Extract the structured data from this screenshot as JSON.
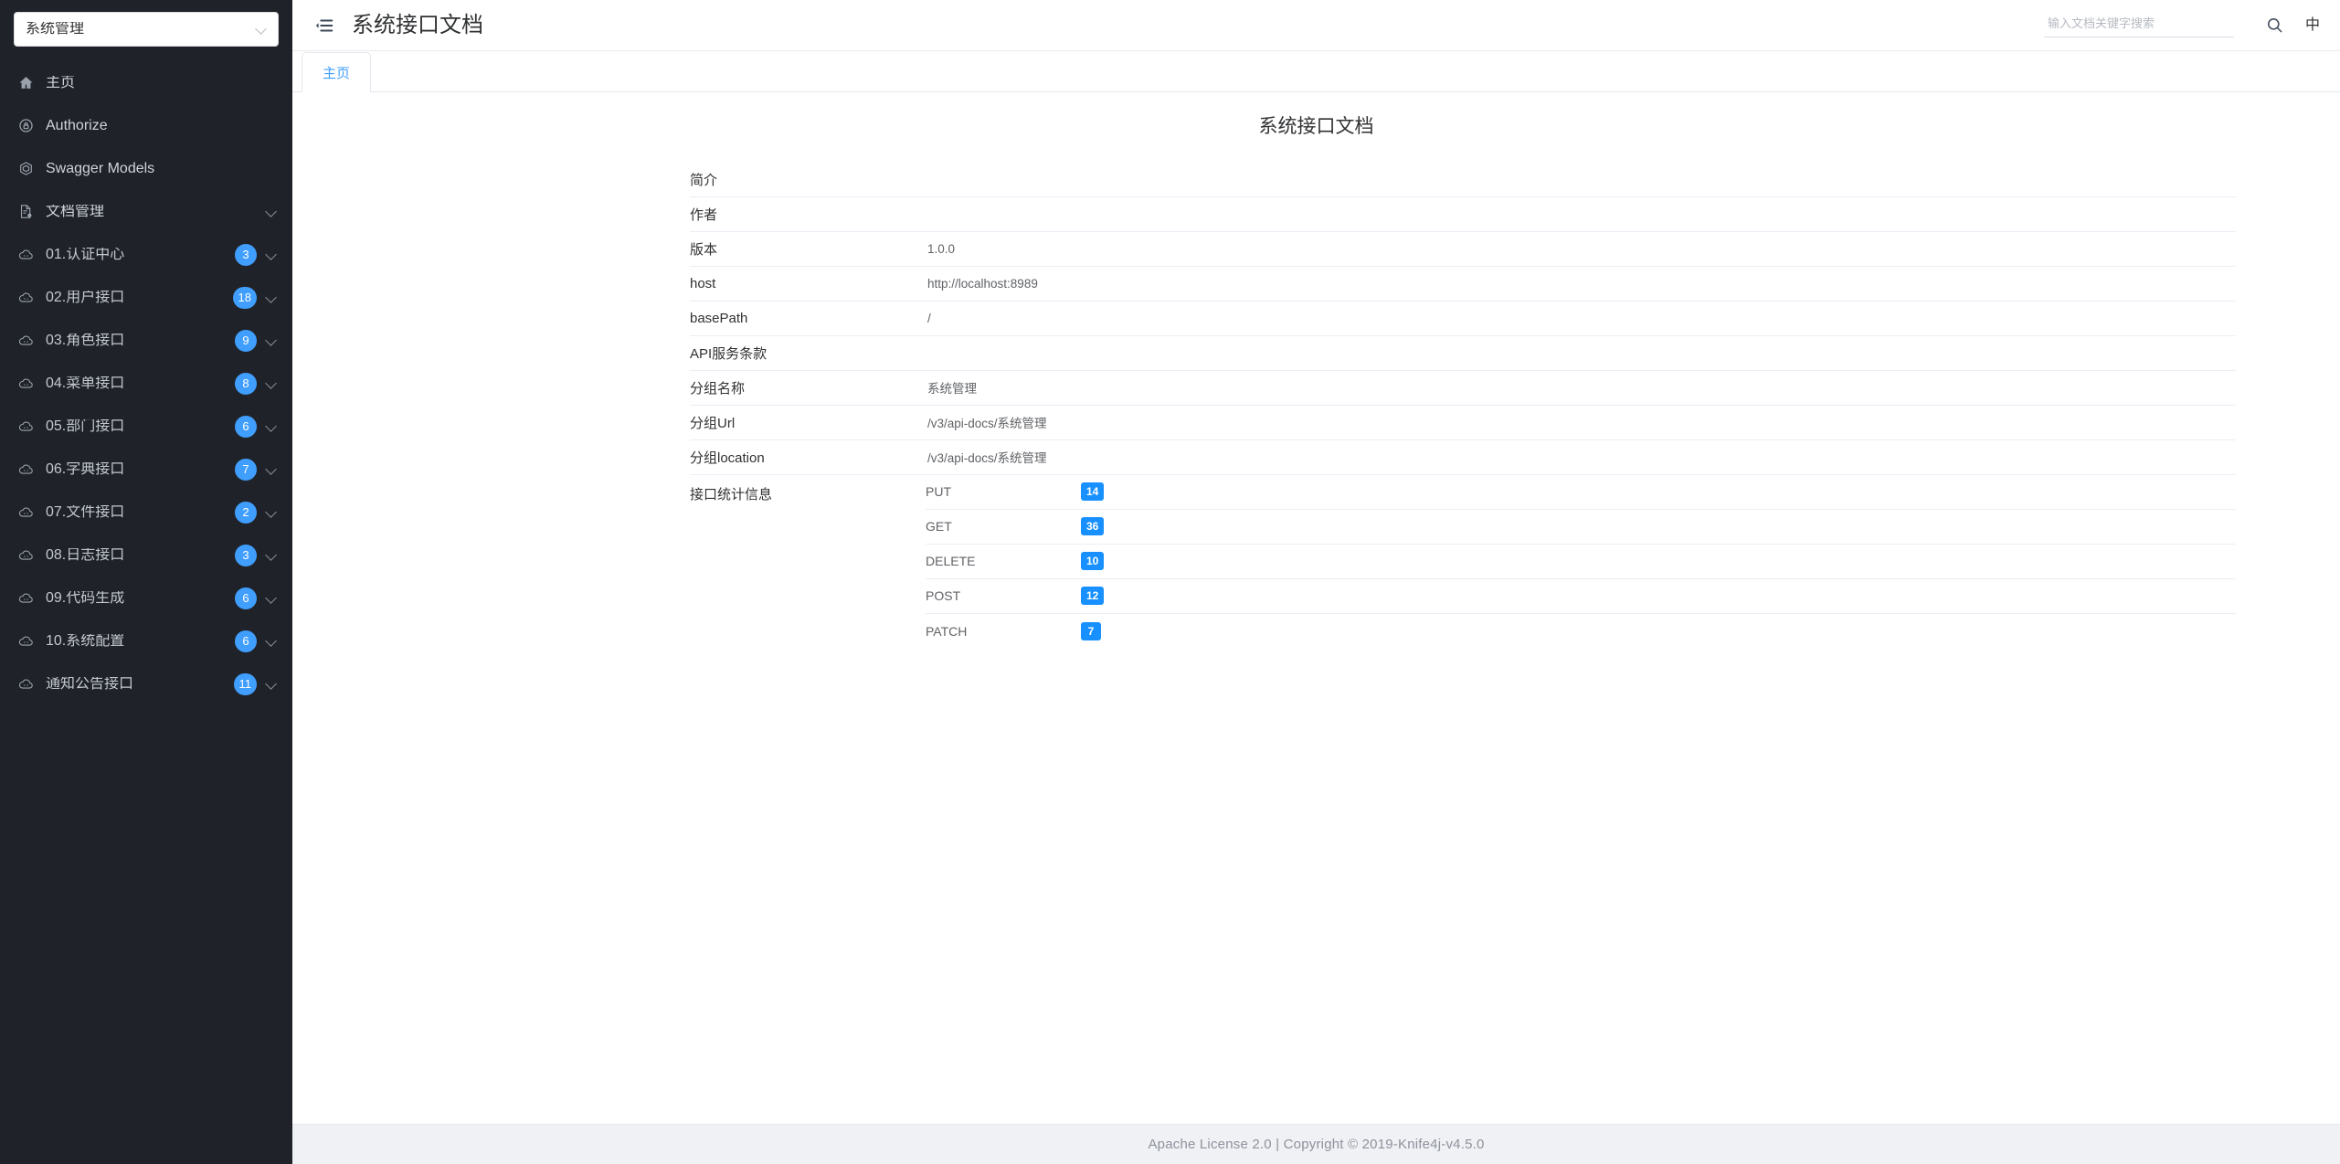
{
  "sidebar": {
    "group_select": {
      "value": "系统管理",
      "icon": "chevron-down-icon"
    },
    "items": [
      {
        "label": "主页",
        "icon": "home-icon",
        "level": 1,
        "badge": null,
        "expandable": false
      },
      {
        "label": "Authorize",
        "icon": "lock-icon",
        "level": 1,
        "badge": null,
        "expandable": false
      },
      {
        "label": "Swagger Models",
        "icon": "model-icon",
        "level": 1,
        "badge": null,
        "expandable": false
      },
      {
        "label": "文档管理",
        "icon": "doc-settings-icon",
        "level": 1,
        "badge": null,
        "expandable": true
      },
      {
        "label": "01.认证中心",
        "icon": "cloud-icon",
        "level": 2,
        "badge": "3",
        "expandable": true
      },
      {
        "label": "02.用户接口",
        "icon": "cloud-icon",
        "level": 2,
        "badge": "18",
        "expandable": true
      },
      {
        "label": "03.角色接口",
        "icon": "cloud-icon",
        "level": 2,
        "badge": "9",
        "expandable": true
      },
      {
        "label": "04.菜单接口",
        "icon": "cloud-icon",
        "level": 2,
        "badge": "8",
        "expandable": true
      },
      {
        "label": "05.部门接口",
        "icon": "cloud-icon",
        "level": 2,
        "badge": "6",
        "expandable": true
      },
      {
        "label": "06.字典接口",
        "icon": "cloud-icon",
        "level": 2,
        "badge": "7",
        "expandable": true
      },
      {
        "label": "07.文件接口",
        "icon": "cloud-icon",
        "level": 2,
        "badge": "2",
        "expandable": true
      },
      {
        "label": "08.日志接口",
        "icon": "cloud-icon",
        "level": 2,
        "badge": "3",
        "expandable": true
      },
      {
        "label": "09.代码生成",
        "icon": "cloud-icon",
        "level": 2,
        "badge": "6",
        "expandable": true
      },
      {
        "label": "10.系统配置",
        "icon": "cloud-icon",
        "level": 2,
        "badge": "6",
        "expandable": true
      },
      {
        "label": "通知公告接口",
        "icon": "cloud-icon",
        "level": 2,
        "badge": "11",
        "expandable": true
      }
    ]
  },
  "header": {
    "fold_icon": "menu-fold-icon",
    "title": "系统接口文档",
    "search": {
      "value": "",
      "placeholder": "输入文档关键字搜索",
      "icon": "search-icon"
    },
    "language_label": "中"
  },
  "tabs": [
    {
      "label": "主页",
      "active": true
    }
  ],
  "main": {
    "doc_title": "系统接口文档",
    "rows": [
      {
        "label": "简介",
        "value": ""
      },
      {
        "label": "作者",
        "value": ""
      },
      {
        "label": "版本",
        "value": "1.0.0"
      },
      {
        "label": "host",
        "value": "http://localhost:8989"
      },
      {
        "label": "basePath",
        "value": "/"
      },
      {
        "label": "API服务条款",
        "value": ""
      },
      {
        "label": "分组名称",
        "value": "系统管理"
      },
      {
        "label": "分组Url",
        "value": "/v3/api-docs/系统管理"
      },
      {
        "label": "分组location",
        "value": "/v3/api-docs/系统管理"
      }
    ],
    "stats_label": "接口统计信息",
    "stats": [
      {
        "method": "PUT",
        "count": "14"
      },
      {
        "method": "GET",
        "count": "36"
      },
      {
        "method": "DELETE",
        "count": "10"
      },
      {
        "method": "POST",
        "count": "12"
      },
      {
        "method": "PATCH",
        "count": "7"
      }
    ]
  },
  "footer": {
    "text": "Apache License 2.0 | Copyright © 2019-Knife4j-v4.5.0"
  },
  "colors": {
    "sidebar_bg": "#1f2329",
    "accent": "#409eff",
    "badge_blue": "#1890ff",
    "footer_bg": "#f0f1f5"
  }
}
